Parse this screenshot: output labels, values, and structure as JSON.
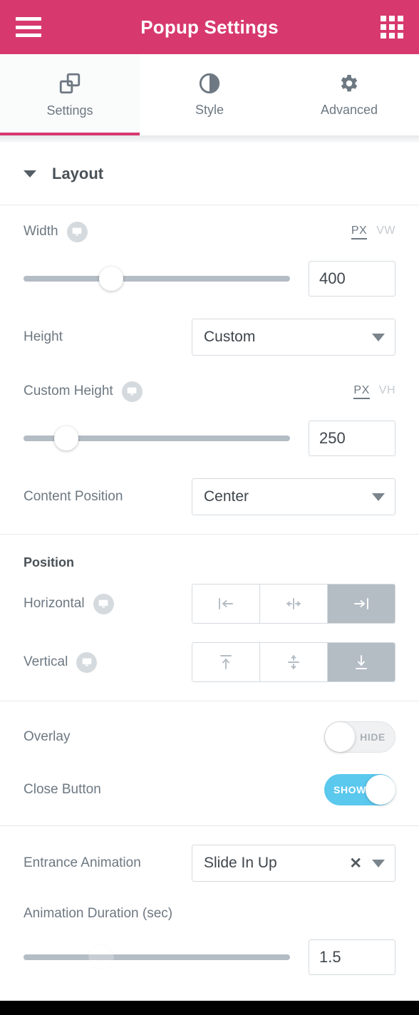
{
  "theme": {
    "accent_pink": "#d7396f",
    "toggle_on_blue": "#5bc8ee",
    "muted_gray": "#6d7882",
    "control_gray": "#b4bcc4"
  },
  "header": {
    "title": "Popup Settings",
    "menu_icon": "hamburger-menu-icon",
    "apps_icon": "apps-grid-icon"
  },
  "tabs": [
    {
      "label": "Settings",
      "icon": "layers-icon",
      "active": true
    },
    {
      "label": "Style",
      "icon": "contrast-icon",
      "active": false
    },
    {
      "label": "Advanced",
      "icon": "gear-icon",
      "active": false
    }
  ],
  "layout_section": {
    "title": "Layout",
    "collapse_icon": "chevron-down-icon",
    "width": {
      "label": "Width",
      "responsive_icon": "desktop-monitor-icon",
      "units": [
        "PX",
        "VW"
      ],
      "selected_unit": "PX",
      "value": "400",
      "slider_percent": 33
    },
    "height": {
      "label": "Height",
      "value": "Custom"
    },
    "custom_height": {
      "label": "Custom Height",
      "responsive_icon": "desktop-monitor-icon",
      "units": [
        "PX",
        "VH"
      ],
      "selected_unit": "PX",
      "value": "250",
      "slider_percent": 16
    },
    "content_position": {
      "label": "Content Position",
      "value": "Center"
    }
  },
  "position_section": {
    "title": "Position",
    "horizontal": {
      "label": "Horizontal",
      "responsive_icon": "desktop-monitor-icon",
      "options": [
        {
          "icon": "align-left-icon",
          "selected": false
        },
        {
          "icon": "align-center-icon",
          "selected": false
        },
        {
          "icon": "align-right-icon",
          "selected": true
        }
      ]
    },
    "vertical": {
      "label": "Vertical",
      "responsive_icon": "desktop-monitor-icon",
      "options": [
        {
          "icon": "align-top-icon",
          "selected": false
        },
        {
          "icon": "align-middle-icon",
          "selected": false
        },
        {
          "icon": "align-bottom-icon",
          "selected": true
        }
      ]
    }
  },
  "toggles_section": {
    "overlay": {
      "label": "Overlay",
      "state": "HIDE",
      "on": false
    },
    "close_button": {
      "label": "Close Button",
      "state": "SHOW",
      "on": true
    }
  },
  "animation_section": {
    "entrance_animation": {
      "label": "Entrance Animation",
      "value": "Slide In Up",
      "clear_icon": "close-x-icon",
      "caret_icon": "chevron-down-icon"
    },
    "animation_duration": {
      "label": "Animation Duration (sec)",
      "value": "1.5",
      "slider_percent": 29
    }
  }
}
